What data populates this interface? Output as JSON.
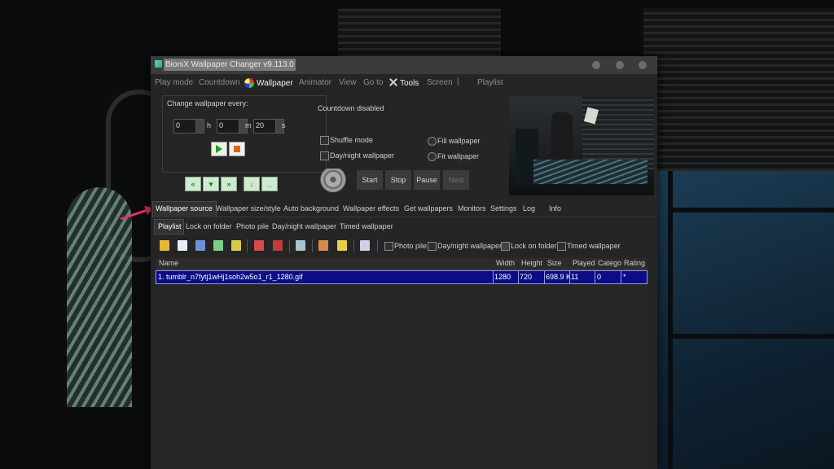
{
  "window": {
    "title": "BioniX Wallpaper Changer v9.113.0"
  },
  "menu": [
    {
      "label": "Play mode",
      "bright": false
    },
    {
      "label": "Countdown",
      "bright": false
    },
    {
      "label": "Wallpaper",
      "bright": true,
      "icon": "leaf-icon"
    },
    {
      "label": "Animator",
      "bright": false
    },
    {
      "label": "View",
      "bright": false
    },
    {
      "label": "Go to",
      "bright": false
    },
    {
      "label": "Tools",
      "bright": true,
      "icon": "tools-icon"
    },
    {
      "label": "Screen",
      "bright": false
    },
    {
      "label": "Playlist",
      "bright": false
    }
  ],
  "menu_separator": "|",
  "timer": {
    "label": "Change wallpaper every:",
    "hours": "0",
    "minutes": "0",
    "seconds": "20",
    "h_unit": "h",
    "m_unit": "m",
    "s_unit": "s"
  },
  "status": "Countdown disabled",
  "options": {
    "shuffle": "Shuffle mode",
    "daynight": "Day/night wallpaper",
    "fill": "Fill wallpaper",
    "fit": "Fit wallpaper"
  },
  "buttons": {
    "start": "Start",
    "stop": "Stop",
    "pause": "Pause",
    "next": "Next"
  },
  "tabs": [
    "Wallpaper source",
    "Wallpaper size/style",
    "Auto background",
    "Wallpaper effects",
    "Get wallpapers",
    "Monitors",
    "Settings",
    "Log",
    "Info"
  ],
  "subtabs": [
    "Playlist",
    "Lock on folder",
    "Photo pile",
    "Day/night wallpaper",
    "Timed wallpaper"
  ],
  "toolbar_checks": {
    "photo_pile": "Photo pile",
    "daynight": "Day/night wallpaper",
    "lock_folder": "Lock on folder",
    "timed": "Timed wallpaper"
  },
  "columns": [
    "Name",
    "Width",
    "Height",
    "Size",
    "Played",
    "Catego",
    "Rating"
  ],
  "rows": [
    {
      "name": "1. tumblr_n7fytj1wHj1soh2w5o1_r1_1280.gif",
      "width": "1280",
      "height": "720",
      "size": "698.9 K",
      "played": "11",
      "category": "0",
      "rating": "*"
    }
  ],
  "colors": {
    "app_bg": "#252526",
    "selected_row": "#0c0c86",
    "accent_arrow": "#e8335d"
  }
}
